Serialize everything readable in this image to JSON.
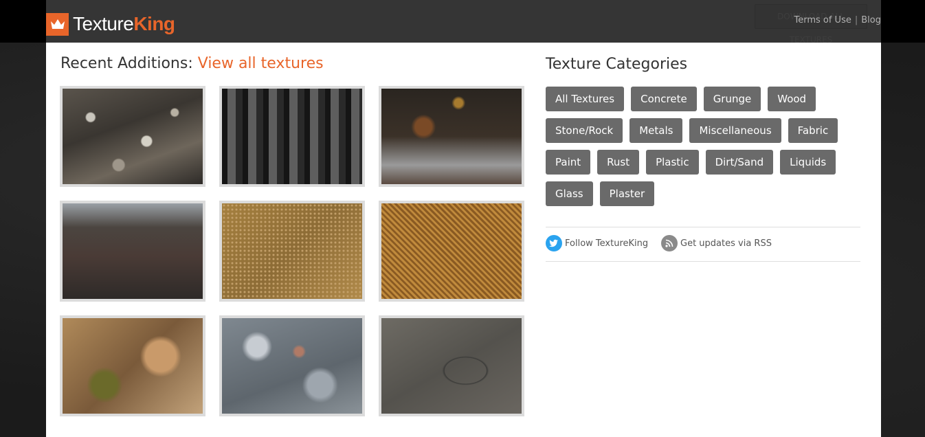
{
  "header": {
    "logo_texture": "Texture",
    "logo_king": "King",
    "ghost_button": "DOWNLOAD ALL TEXTURES",
    "links": [
      "Terms of Use",
      "Blog"
    ]
  },
  "recent": {
    "heading": "Recent Additions:",
    "view_all": "View all textures",
    "thumbnails": [
      {
        "name": "leaf-litter-texture"
      },
      {
        "name": "burnt-wood-texture"
      },
      {
        "name": "dark-rust-texture"
      },
      {
        "name": "rusty-metal-texture"
      },
      {
        "name": "sand-gravel-texture"
      },
      {
        "name": "woven-jute-texture"
      },
      {
        "name": "rock-surface-texture"
      },
      {
        "name": "grey-rock-texture"
      },
      {
        "name": "slate-stone-texture"
      }
    ]
  },
  "categories": {
    "heading": "Texture Categories",
    "rows": [
      [
        "All Textures",
        "Concrete",
        "Grunge",
        "Wood"
      ],
      [
        "Stone/Rock",
        "Metals",
        "Miscellaneous",
        "Fabric"
      ],
      [
        "Paint",
        "Rust",
        "Plastic",
        "Dirt/Sand",
        "Liquids"
      ],
      [
        "Glass",
        "Plaster"
      ]
    ]
  },
  "follow": {
    "twitter_label": "Follow TextureKing",
    "rss_label": "Get updates via RSS"
  },
  "colors": {
    "accent": "#e8652a",
    "category_bg": "#6a6a6a",
    "twitter": "#2aa3ef",
    "rss": "#8a8a8a"
  }
}
